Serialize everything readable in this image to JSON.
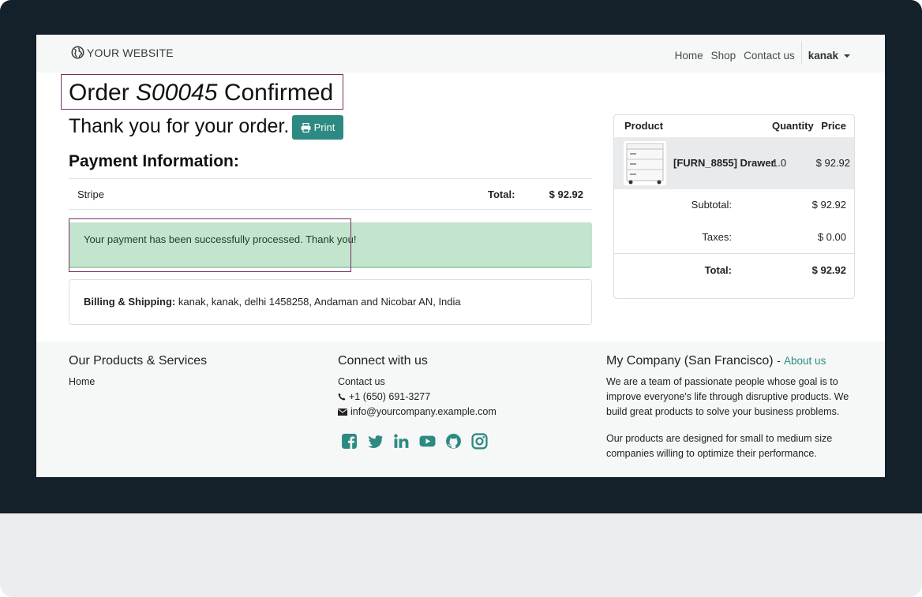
{
  "navbar": {
    "brand": "YOUR WEBSITE",
    "links": [
      "Home",
      "Shop",
      "Contact us"
    ],
    "user": "kanak"
  },
  "order": {
    "title_prefix": "Order",
    "number": "S00045",
    "title_suffix": "Confirmed",
    "thanks": "Thank you for your order.",
    "print_label": "Print"
  },
  "payment": {
    "heading": "Payment Information:",
    "method": "Stripe",
    "total_label": "Total:",
    "total_value": "$ 92.92",
    "success_message": "Your payment has been successfully processed. Thank you!"
  },
  "billing": {
    "label": "Billing & Shipping:",
    "address": "kanak, kanak, delhi 1458258, Andaman and Nicobar AN, India"
  },
  "summary": {
    "headers": {
      "product": "Product",
      "quantity": "Quantity",
      "price": "Price"
    },
    "item": {
      "name": "[FURN_8855] Drawer",
      "quantity": "1.0",
      "price": "$ 92.92"
    },
    "subtotal_label": "Subtotal:",
    "subtotal_value": "$ 92.92",
    "taxes_label": "Taxes:",
    "taxes_value": "$ 0.00",
    "total_label": "Total:",
    "total_value": "$ 92.92"
  },
  "footer": {
    "col1": {
      "heading": "Our Products & Services",
      "link": "Home"
    },
    "col2": {
      "heading": "Connect with us",
      "contact_link": "Contact us",
      "phone": "+1 (650) 691-3277",
      "email": "info@yourcompany.example.com",
      "social_icons": [
        "facebook-icon",
        "twitter-icon",
        "linkedin-icon",
        "youtube-icon",
        "github-icon",
        "instagram-icon"
      ]
    },
    "col3": {
      "heading": "My Company (San Francisco)",
      "about_sep": "-",
      "about_link": "About us",
      "para1_l1": "We are a team of passionate people whose goal is to",
      "para1_l2": "improve everyone's life through disruptive products. We",
      "para1_l3": "build great products to solve your business problems.",
      "para2_l1": "Our products are designed for small to medium size",
      "para2_l2": "companies willing to optimize their performance."
    }
  },
  "colors": {
    "accent": "#2d8a82",
    "frame": "#14202a",
    "highlight_border": "#7b2f63",
    "alert_bg": "#c3e4cd"
  }
}
